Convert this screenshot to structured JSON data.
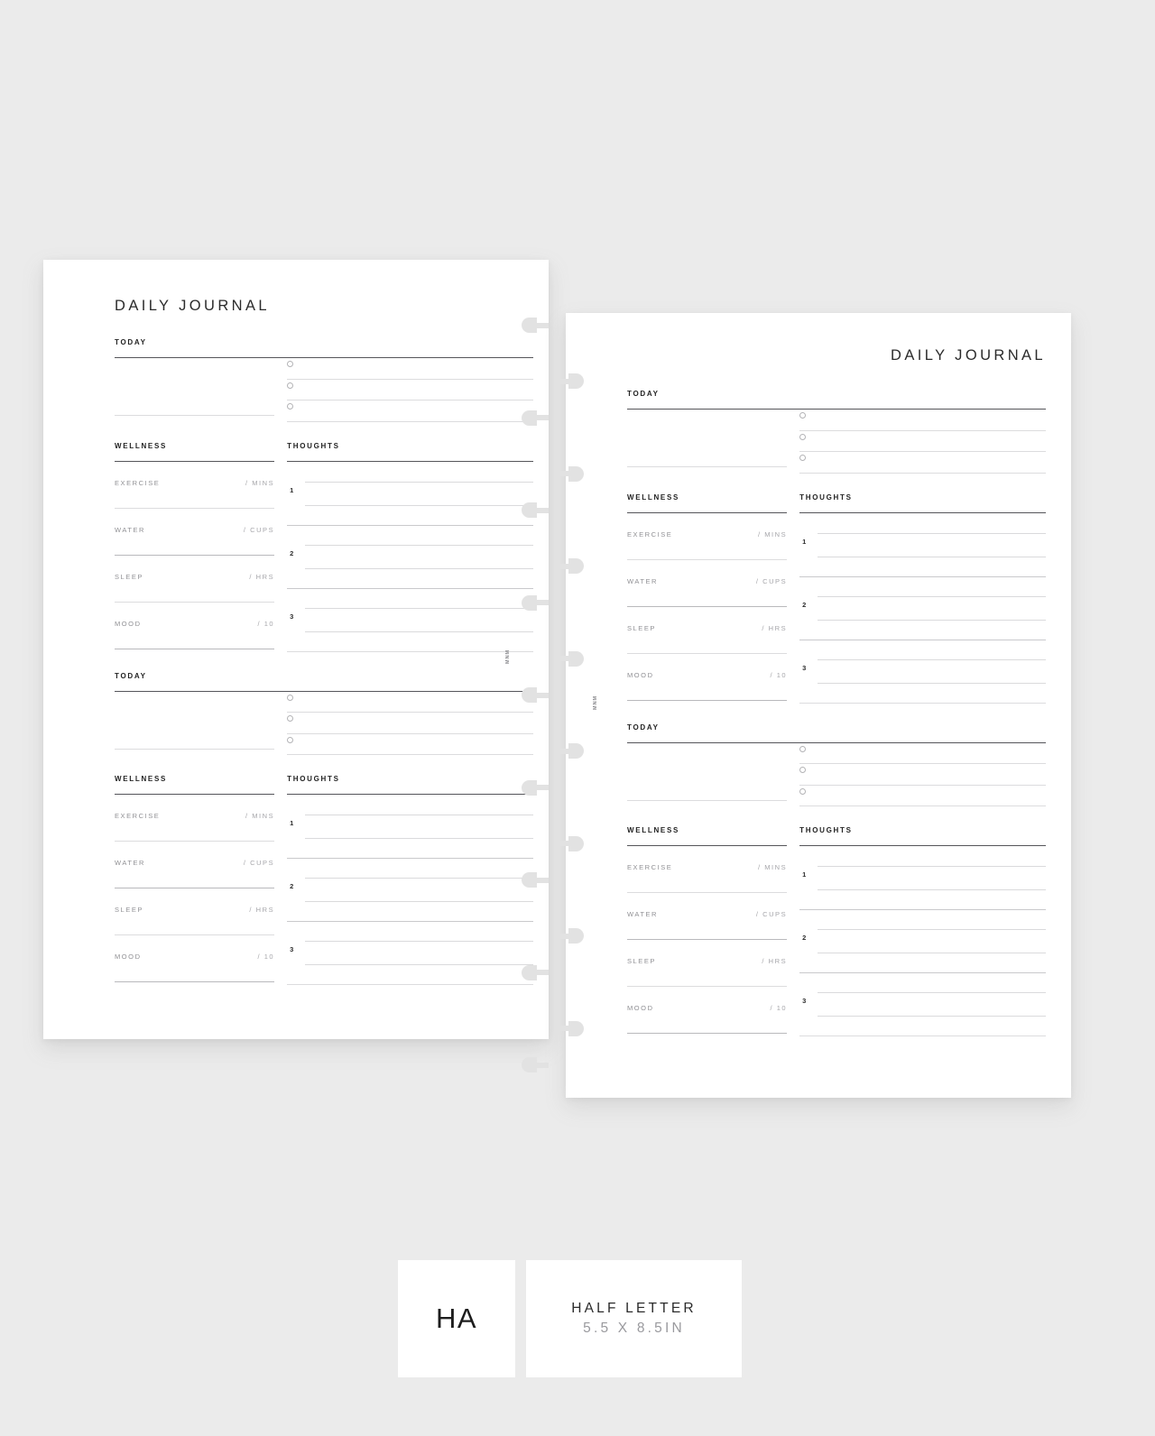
{
  "meta": {
    "background_color": "#ebebeb",
    "page_color": "#ffffff",
    "accent_text_color": "#2b2b2b",
    "muted_text_color": "#909094"
  },
  "pages": [
    {
      "id": "left",
      "title": "DAILY JOURNAL",
      "title_align": "left",
      "brand_mark": "MNM",
      "sections": [
        {
          "today_label": "TODAY",
          "checklist": [
            {
              "circle": "radio-circle-icon",
              "value": ""
            },
            {
              "circle": "radio-circle-icon",
              "value": ""
            },
            {
              "circle": "radio-circle-icon",
              "value": ""
            }
          ],
          "wellness_label": "WELLNESS",
          "wellness_rows": [
            {
              "name": "EXERCISE",
              "unit": "/ MINS"
            },
            {
              "name": "WATER",
              "unit": "/ CUPS"
            },
            {
              "name": "SLEEP",
              "unit": "/ HRS"
            },
            {
              "name": "MOOD",
              "unit": "/ 10"
            }
          ],
          "thoughts_label": "THOUGHTS",
          "thoughts_rows": [
            {
              "number": "1",
              "value": ""
            },
            {
              "number": "2",
              "value": ""
            },
            {
              "number": "3",
              "value": ""
            }
          ]
        },
        {
          "today_label": "TODAY",
          "checklist": [
            {
              "circle": "radio-circle-icon",
              "value": ""
            },
            {
              "circle": "radio-circle-icon",
              "value": ""
            },
            {
              "circle": "radio-circle-icon",
              "value": ""
            }
          ],
          "wellness_label": "WELLNESS",
          "wellness_rows": [
            {
              "name": "EXERCISE",
              "unit": "/ MINS"
            },
            {
              "name": "WATER",
              "unit": "/ CUPS"
            },
            {
              "name": "SLEEP",
              "unit": "/ HRS"
            },
            {
              "name": "MOOD",
              "unit": "/ 10"
            }
          ],
          "thoughts_label": "THOUGHTS",
          "thoughts_rows": [
            {
              "number": "1",
              "value": ""
            },
            {
              "number": "2",
              "value": ""
            },
            {
              "number": "3",
              "value": ""
            }
          ]
        }
      ]
    },
    {
      "id": "right",
      "title": "DAILY JOURNAL",
      "title_align": "right",
      "brand_mark": "MNM",
      "sections": [
        {
          "today_label": "TODAY",
          "checklist": [
            {
              "circle": "radio-circle-icon",
              "value": ""
            },
            {
              "circle": "radio-circle-icon",
              "value": ""
            },
            {
              "circle": "radio-circle-icon",
              "value": ""
            }
          ],
          "wellness_label": "WELLNESS",
          "wellness_rows": [
            {
              "name": "EXERCISE",
              "unit": "/ MINS"
            },
            {
              "name": "WATER",
              "unit": "/ CUPS"
            },
            {
              "name": "SLEEP",
              "unit": "/ HRS"
            },
            {
              "name": "MOOD",
              "unit": "/ 10"
            }
          ],
          "thoughts_label": "THOUGHTS",
          "thoughts_rows": [
            {
              "number": "1",
              "value": ""
            },
            {
              "number": "2",
              "value": ""
            },
            {
              "number": "3",
              "value": ""
            }
          ]
        },
        {
          "today_label": "TODAY",
          "checklist": [
            {
              "circle": "radio-circle-icon",
              "value": ""
            },
            {
              "circle": "radio-circle-icon",
              "value": ""
            },
            {
              "circle": "radio-circle-icon",
              "value": ""
            }
          ],
          "wellness_label": "WELLNESS",
          "wellness_rows": [
            {
              "name": "EXERCISE",
              "unit": "/ MINS"
            },
            {
              "name": "WATER",
              "unit": "/ CUPS"
            },
            {
              "name": "SLEEP",
              "unit": "/ HRS"
            },
            {
              "name": "MOOD",
              "unit": "/ 10"
            }
          ],
          "thoughts_label": "THOUGHTS",
          "thoughts_rows": [
            {
              "number": "1",
              "value": ""
            },
            {
              "number": "2",
              "value": ""
            },
            {
              "number": "3",
              "value": ""
            }
          ]
        }
      ]
    }
  ],
  "binding": {
    "hole_count_left": 9,
    "hole_count_right": 8,
    "hole_color": "#e2e2e2"
  },
  "footer": {
    "logo": "HA",
    "size_title": "HALF LETTER",
    "size_sub": "5.5 X 8.5IN"
  }
}
